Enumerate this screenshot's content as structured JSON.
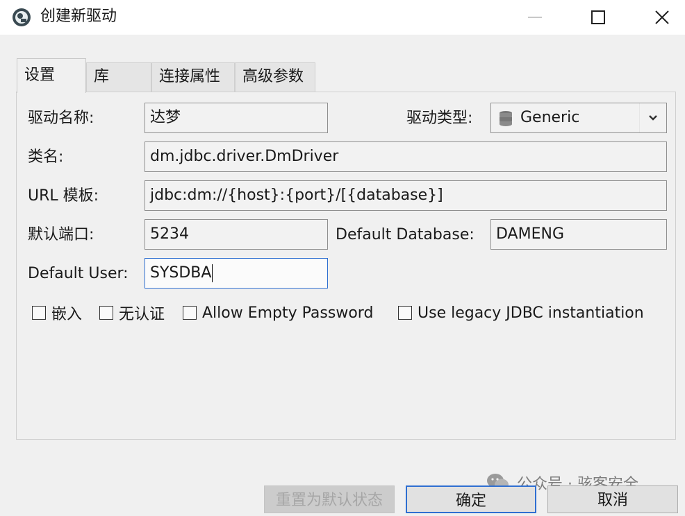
{
  "window": {
    "title": "创建新驱动",
    "icon": "driver-gear-icon",
    "controls": {
      "minimize": "minimize-icon",
      "maximize": "maximize-icon",
      "close": "close-icon"
    }
  },
  "tabs": [
    {
      "label": "设置",
      "active": true
    },
    {
      "label": "库",
      "active": false
    },
    {
      "label": "连接属性",
      "active": false
    },
    {
      "label": "高级参数",
      "active": false
    }
  ],
  "form": {
    "driver_name": {
      "label": "驱动名称:",
      "value": "达梦"
    },
    "driver_type": {
      "label": "驱动类型:",
      "value": "Generic",
      "icon": "database-icon"
    },
    "class_name": {
      "label": "类名:",
      "value": "dm.jdbc.driver.DmDriver"
    },
    "url_template": {
      "label": "URL 模板:",
      "value": "jdbc:dm://{host}:{port}/[{database}]"
    },
    "default_port": {
      "label": "默认端口:",
      "value": "5234"
    },
    "default_database": {
      "label": "Default Database:",
      "value": "DAMENG"
    },
    "default_user": {
      "label": "Default User:",
      "value": "SYSDBA"
    }
  },
  "checkboxes": [
    {
      "label": "嵌入",
      "checked": false
    },
    {
      "label": "无认证",
      "checked": false
    },
    {
      "label": "Allow Empty Password",
      "checked": false
    },
    {
      "label": "Use legacy JDBC instantiation",
      "checked": false
    }
  ],
  "buttons": {
    "reset": "重置为默认状态",
    "ok": "确定",
    "cancel": "取消"
  },
  "watermark": {
    "text": "公众号 · 骇客安全",
    "icon": "wechat-icon"
  },
  "colors": {
    "focus_border": "#2f6fd1",
    "background": "#f0f0f0"
  }
}
